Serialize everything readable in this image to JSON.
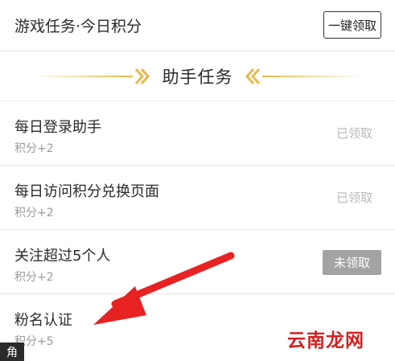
{
  "game_task": {
    "title": "游戏任务·今日积分",
    "claim_all_label": "一键领取"
  },
  "section": {
    "title": "助手任务",
    "accent_color": "#e8b948"
  },
  "tasks": [
    {
      "name": "每日登录助手",
      "points": "积分+2",
      "status": "已领取"
    },
    {
      "name": "每日访问积分兑换页面",
      "points": "积分+2",
      "status": "已领取"
    },
    {
      "name": "关注超过5个人",
      "points": "积分+2",
      "status": "未领取"
    },
    {
      "name": "粉名认证",
      "points": "积分+5",
      "status": ""
    }
  ],
  "annotation": {
    "arrow_color": "#e62222"
  },
  "corner_tab": {
    "label": "角"
  },
  "watermark": {
    "text": "云南龙网"
  }
}
